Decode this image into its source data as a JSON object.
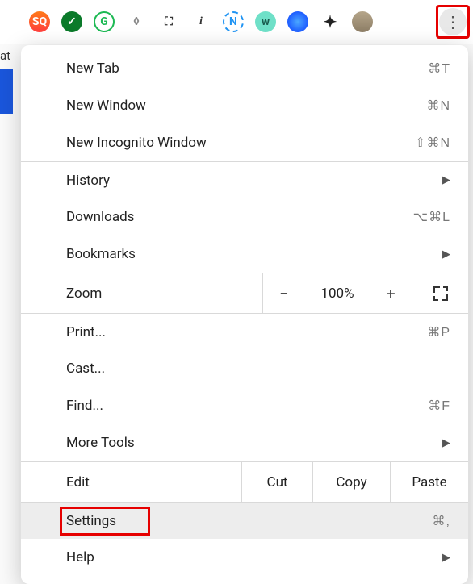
{
  "toolbar": {
    "at_text": "at"
  },
  "menu": {
    "new_tab": {
      "label": "New Tab",
      "shortcut": "⌘T"
    },
    "new_window": {
      "label": "New Window",
      "shortcut": "⌘N"
    },
    "new_incognito": {
      "label": "New Incognito Window",
      "shortcut": "⇧⌘N"
    },
    "history": {
      "label": "History"
    },
    "downloads": {
      "label": "Downloads",
      "shortcut": "⌥⌘L"
    },
    "bookmarks": {
      "label": "Bookmarks"
    },
    "zoom": {
      "label": "Zoom",
      "minus": "−",
      "value": "100%",
      "plus": "+"
    },
    "print": {
      "label": "Print...",
      "shortcut": "⌘P"
    },
    "cast": {
      "label": "Cast..."
    },
    "find": {
      "label": "Find...",
      "shortcut": "⌘F"
    },
    "more_tools": {
      "label": "More Tools"
    },
    "edit": {
      "label": "Edit",
      "cut": "Cut",
      "copy": "Copy",
      "paste": "Paste"
    },
    "settings": {
      "label": "Settings",
      "shortcut": "⌘,"
    },
    "help": {
      "label": "Help"
    }
  }
}
